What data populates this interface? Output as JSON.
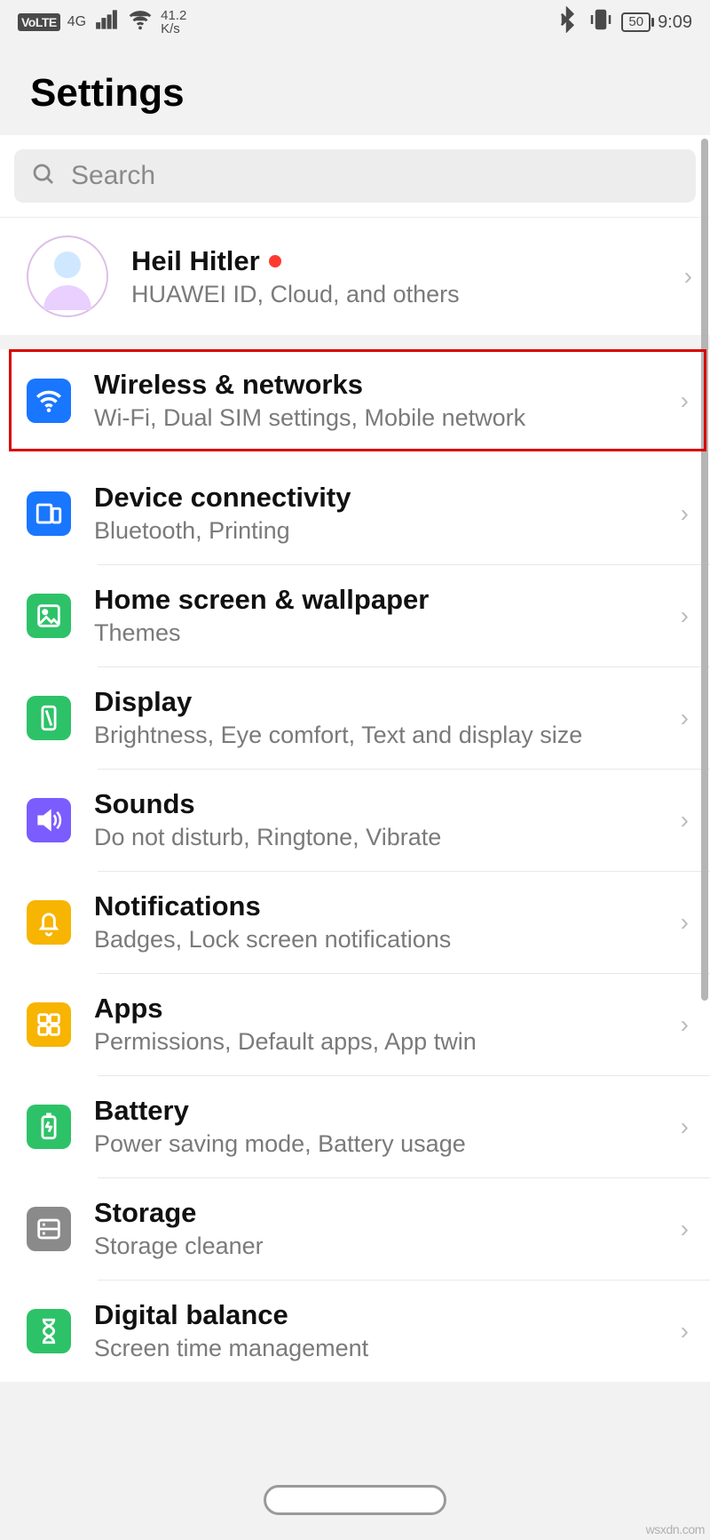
{
  "status": {
    "volte": "VoLTE",
    "net_gen": "4G",
    "speed_top": "41.2",
    "speed_unit": "K/s",
    "battery": "50",
    "time": "9:09"
  },
  "header": {
    "title": "Settings"
  },
  "search": {
    "placeholder": "Search"
  },
  "account": {
    "name": "Heil Hitler",
    "subtitle": "HUAWEI ID, Cloud, and others"
  },
  "groups": [
    {
      "items": [
        {
          "key": "wireless",
          "title": "Wireless & networks",
          "subtitle": "Wi-Fi, Dual SIM settings, Mobile network",
          "color": "c-blue",
          "highlighted": true
        }
      ]
    },
    {
      "items": [
        {
          "key": "connectivity",
          "title": "Device connectivity",
          "subtitle": "Bluetooth, Printing",
          "color": "c-blue"
        },
        {
          "key": "home",
          "title": "Home screen & wallpaper",
          "subtitle": "Themes",
          "color": "c-green"
        },
        {
          "key": "display",
          "title": "Display",
          "subtitle": "Brightness, Eye comfort, Text and display size",
          "color": "c-green"
        },
        {
          "key": "sounds",
          "title": "Sounds",
          "subtitle": "Do not disturb, Ringtone, Vibrate",
          "color": "c-purple"
        },
        {
          "key": "notifications",
          "title": "Notifications",
          "subtitle": "Badges, Lock screen notifications",
          "color": "c-amber"
        },
        {
          "key": "apps",
          "title": "Apps",
          "subtitle": "Permissions, Default apps, App twin",
          "color": "c-amber"
        },
        {
          "key": "battery",
          "title": "Battery",
          "subtitle": "Power saving mode, Battery usage",
          "color": "c-green"
        },
        {
          "key": "storage",
          "title": "Storage",
          "subtitle": "Storage cleaner",
          "color": "c-grey"
        },
        {
          "key": "digital",
          "title": "Digital balance",
          "subtitle": "Screen time management",
          "color": "c-green"
        }
      ]
    }
  ],
  "watermark": "wsxdn.com"
}
